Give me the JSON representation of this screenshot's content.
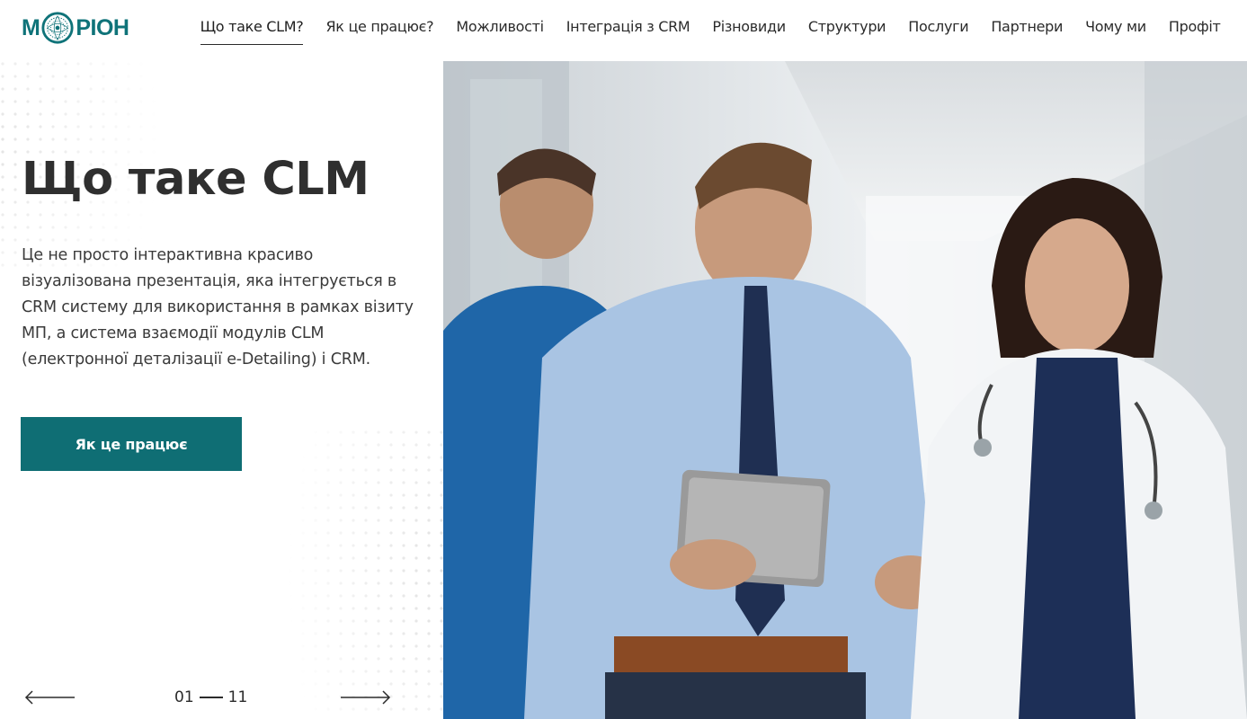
{
  "brand": {
    "logo_text_left": "М",
    "logo_text_right": "РІОН",
    "accent_color": "#0f6e74"
  },
  "nav": {
    "items": [
      {
        "label": "Що таке CLM?",
        "active": true
      },
      {
        "label": "Як це працює?"
      },
      {
        "label": "Можливості"
      },
      {
        "label": "Інтеграція з CRM"
      },
      {
        "label": "Різновиди"
      },
      {
        "label": "Структури"
      },
      {
        "label": "Послуги"
      },
      {
        "label": "Партнери"
      },
      {
        "label": "Чому ми"
      },
      {
        "label": "Профіт"
      }
    ]
  },
  "hero": {
    "title": "Що таке CLM",
    "text": "Це не просто інтерактивна красиво візуалізована презентація, яка інтегрується в CRM систему для використання в рамках візиту МП, а система взаємодії модулів CLM (електронної деталізації e-Detailing) і CRM.",
    "cta_label": "Як це працює"
  },
  "slider": {
    "current": "01",
    "total": "11",
    "prev_icon": "arrow-left-icon",
    "next_icon": "arrow-right-icon"
  },
  "photo": {
    "description_icon": "doctors-photo"
  }
}
